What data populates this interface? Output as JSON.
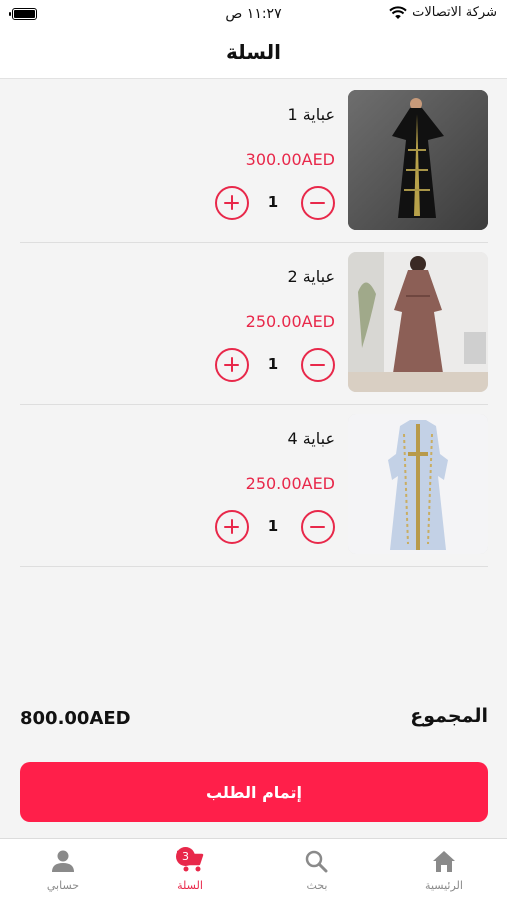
{
  "status_bar": {
    "carrier": "شركة الاتصالات",
    "time": "١١:٢٧ ص"
  },
  "header": {
    "title": "السلة"
  },
  "cart": {
    "items": [
      {
        "name": "عباية 1",
        "price": "300.00AED",
        "quantity": "1",
        "image": "black-abaya-photo"
      },
      {
        "name": "عباية 2",
        "price": "250.00AED",
        "quantity": "1",
        "image": "brown-abaya-photo"
      },
      {
        "name": "عباية 4",
        "price": "250.00AED",
        "quantity": "1",
        "image": "light-blue-abaya-photo"
      }
    ]
  },
  "summary": {
    "total_label": "المجموع",
    "total_value": "800.00AED"
  },
  "checkout": {
    "label": "إتمام الطلب"
  },
  "tabs": [
    {
      "label": "حسابي",
      "icon": "person-icon"
    },
    {
      "label": "السلة",
      "icon": "cart-icon",
      "badge": "3",
      "active": true
    },
    {
      "label": "بحث",
      "icon": "search-icon"
    },
    {
      "label": "الرئيسية",
      "icon": "home-icon"
    }
  ],
  "colors": {
    "accent": "#e8284a",
    "checkout_button": "#ff1f4a",
    "inactive_tab": "#8a8a8a"
  }
}
